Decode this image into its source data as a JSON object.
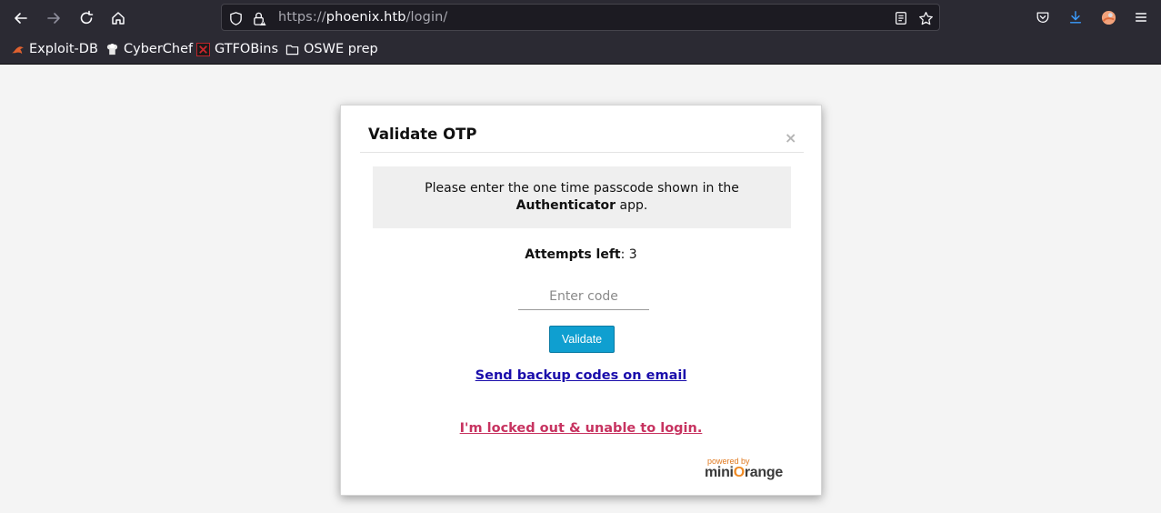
{
  "browser": {
    "url_scheme": "https://",
    "url_host": "phoenix.htb",
    "url_path": "/login/",
    "bookmarks": [
      {
        "label": "Exploit-DB",
        "icon": "exploitdb-icon"
      },
      {
        "label": "CyberChef",
        "icon": "cyberchef-icon"
      },
      {
        "label": "GTFOBins",
        "icon": "gtfobins-icon"
      },
      {
        "label": "OSWE prep",
        "icon": "folder-icon"
      }
    ]
  },
  "modal": {
    "title": "Validate OTP",
    "close": "×",
    "info_line1": "Please enter the one time passcode shown in the",
    "info_bold": "Authenticator",
    "info_tail": " app.",
    "attempts_label": "Attempts left",
    "attempts_sep": ": ",
    "attempts_value": "3",
    "code_placeholder": "Enter code",
    "validate_label": "Validate",
    "backup_link": "Send backup codes on email",
    "locked_link": "I'm locked out & unable to login.",
    "powered_by": "powered by",
    "logo_left": "mini",
    "logo_o": "O",
    "logo_right": "range"
  },
  "colors": {
    "chrome_bg": "#2b2a33",
    "page_bg": "#f4f4f4",
    "validate_btn": "#0f9fd0",
    "backup_link": "#1a0dab",
    "locked_link": "#c73360",
    "brand_orange": "#f08a24"
  }
}
